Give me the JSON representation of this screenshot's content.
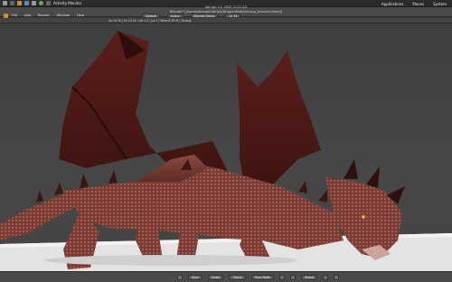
{
  "os_panel": {
    "left_label": "Activity Monitor",
    "right_items": [
      "Applications",
      "Places",
      "System"
    ]
  },
  "blender": {
    "title_line1": "Sat Apr 11, 2015  21:21:25",
    "title_line2": "Blender* [/home/smaug/tutorials/DragonModel/smaug_textured.blend]",
    "menu": [
      "File",
      "Add",
      "Render",
      "Window",
      "Help"
    ],
    "screen_field": "Default",
    "scene_field": "Scene",
    "engine_field": "Blender Game",
    "version_field": "v2.74",
    "info_text": "Ve:14.3k | Fa:13.2k | Ob:1-2 | La:1 | Mem:8.16 M | Smaug",
    "bottom": {
      "view_label": "View",
      "select_label": "Select",
      "object_label": "Object",
      "mode_field": "Pose Mode",
      "global_field": "Global"
    }
  }
}
